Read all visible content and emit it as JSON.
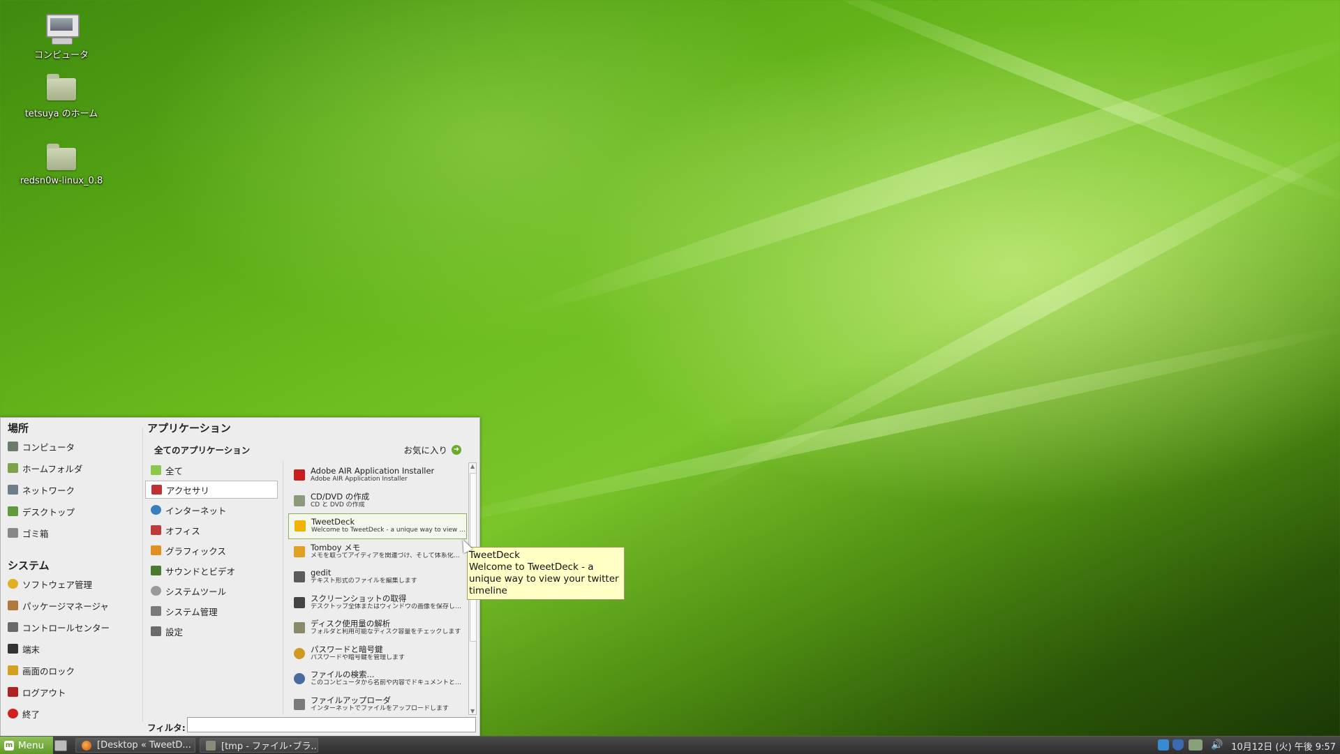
{
  "desktop": {
    "icons": [
      {
        "label": "コンピュータ",
        "icon": "computer-icon"
      },
      {
        "label": "tetsuya のホーム",
        "icon": "home-folder-icon"
      },
      {
        "label": "redsn0w-linux_0.8",
        "icon": "folder-icon"
      }
    ]
  },
  "menu": {
    "places_title": "場所",
    "places": [
      {
        "label": "コンピュータ",
        "icon": "computer-icon",
        "color": "#6c7a6c"
      },
      {
        "label": "ホームフォルダ",
        "icon": "home-icon",
        "color": "#7ca34a"
      },
      {
        "label": "ネットワーク",
        "icon": "network-icon",
        "color": "#6f7f8a"
      },
      {
        "label": "デスクトップ",
        "icon": "desktop-icon",
        "color": "#5f9a3c"
      },
      {
        "label": "ゴミ箱",
        "icon": "trash-icon",
        "color": "#888888"
      }
    ],
    "system_title": "システム",
    "system": [
      {
        "label": "ソフトウェア管理",
        "icon": "software-manager-icon",
        "color": "#e0b020"
      },
      {
        "label": "パッケージマネージャ",
        "icon": "package-manager-icon",
        "color": "#b07a3c"
      },
      {
        "label": "コントロールセンター",
        "icon": "control-center-icon",
        "color": "#6a6a6a"
      },
      {
        "label": "端末",
        "icon": "terminal-icon",
        "color": "#333333"
      },
      {
        "label": "画面のロック",
        "icon": "lock-icon",
        "color": "#d4a020"
      },
      {
        "label": "ログアウト",
        "icon": "logout-icon",
        "color": "#b02020"
      },
      {
        "label": "終了",
        "icon": "power-icon",
        "color": "#d02020"
      }
    ],
    "apps_title": "アプリケーション",
    "all_apps_label": "全てのアプリケーション",
    "favorites_label": "お気に入り",
    "categories": [
      {
        "label": "全て",
        "icon": "all-icon",
        "color": "#8cc84b"
      },
      {
        "label": "アクセサリ",
        "icon": "accessories-icon",
        "color": "#c03030"
      },
      {
        "label": "インターネット",
        "icon": "internet-icon",
        "color": "#3a7ec0"
      },
      {
        "label": "オフィス",
        "icon": "office-icon",
        "color": "#c03a3a"
      },
      {
        "label": "グラフィックス",
        "icon": "graphics-icon",
        "color": "#e09020"
      },
      {
        "label": "サウンドとビデオ",
        "icon": "sound-video-icon",
        "color": "#4a7a30"
      },
      {
        "label": "システムツール",
        "icon": "system-tools-icon",
        "color": "#9a9a9a"
      },
      {
        "label": "システム管理",
        "icon": "system-admin-icon",
        "color": "#7a7a7a"
      },
      {
        "label": "設定",
        "icon": "settings-icon",
        "color": "#6a6a6a"
      }
    ],
    "selected_category": "アクセサリ",
    "apps": [
      {
        "name": "Adobe AIR Application Installer",
        "desc": "Adobe AIR Application Installer",
        "icon": "adobe-air-icon",
        "color": "#c81e1e"
      },
      {
        "name": "CD/DVD の作成",
        "desc": "CD と DVD の作成",
        "icon": "cd-dvd-icon",
        "color": "#8a9a7a"
      },
      {
        "name": "TweetDeck",
        "desc": "Welcome to TweetDeck - a unique way to view yo...",
        "icon": "tweetdeck-icon",
        "color": "#f0b400"
      },
      {
        "name": "Tomboy メモ",
        "desc": "メモを取ってアイディアを関連づけ、そして体系化します",
        "icon": "tomboy-icon",
        "color": "#e0a020"
      },
      {
        "name": "gedit",
        "desc": "テキスト形式のファイルを編集します",
        "icon": "gedit-icon",
        "color": "#5a5a5a"
      },
      {
        "name": "スクリーンショットの取得",
        "desc": "デスクトップ全体またはウィンドウの画像を保存します",
        "icon": "screenshot-icon",
        "color": "#444444"
      },
      {
        "name": "ディスク使用量の解析",
        "desc": "フォルダと利用可能なディスク容量をチェックします",
        "icon": "disk-usage-icon",
        "color": "#8a8a6a"
      },
      {
        "name": "パスワードと暗号鍵",
        "desc": "パスワードや暗号鍵を管理します",
        "icon": "passwords-keys-icon",
        "color": "#d09a20"
      },
      {
        "name": "ファイルの検索...",
        "desc": "このコンピュータから名前や内容でドキュメントとフォルダ...",
        "icon": "search-files-icon",
        "color": "#4a6aa0"
      },
      {
        "name": "ファイルアップローダ",
        "desc": "インターネットでファイルをアップロードします",
        "icon": "file-uploader-icon",
        "color": "#7a7a7a"
      }
    ],
    "selected_app": "TweetDeck",
    "filter_label": "フィルタ:",
    "filter_value": ""
  },
  "tooltip": {
    "title": "TweetDeck",
    "body": "Welcome to TweetDeck - a unique way to view your twitter timeline"
  },
  "taskbar": {
    "menu_label": "Menu",
    "tasks": [
      {
        "label": "[Desktop « TweetD...",
        "icon": "firefox-icon"
      },
      {
        "label": "[tmp - ファイル･ブラ...",
        "icon": "file-browser-icon"
      }
    ],
    "tray_icons": [
      "dropbox-icon",
      "shield-update-icon",
      "network-status-icon",
      "volume-icon"
    ],
    "clock": "10月12日 (火) 午後 9:57"
  },
  "colors": {
    "accent": "#6caa2c",
    "tooltip_bg": "#ffffc6",
    "menu_bg": "#ededed"
  }
}
